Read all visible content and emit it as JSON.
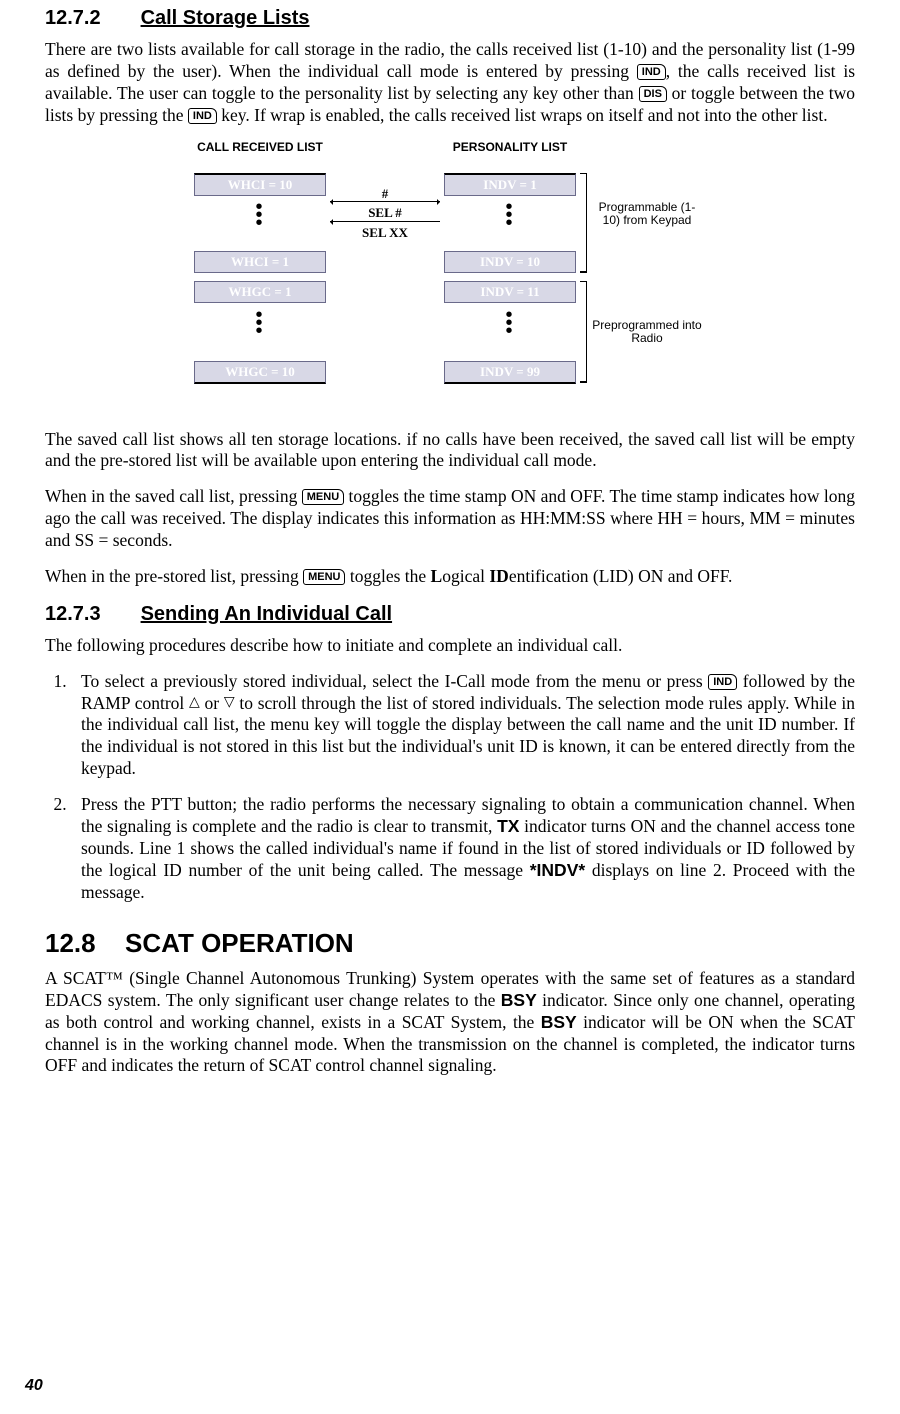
{
  "sections": {
    "s1": {
      "num": "12.7.2",
      "title": "Call Storage Lists"
    },
    "s2": {
      "num": "12.7.3",
      "title": "Sending An Individual Call"
    },
    "s3": {
      "num": "12.8",
      "title": "SCAT OPERATION"
    }
  },
  "keys": {
    "ind": "IND",
    "dis": "DIS",
    "menu": "MENU"
  },
  "body": {
    "p1a": "There are two lists available for call storage in the radio, the calls received list (1-10) and the personality list (1-99 as defined by the user). When the individual call mode is entered by pressing ",
    "p1b": ", the calls received list is available. The user can toggle to the personality list by selecting any key other than ",
    "p1c": " or toggle between the two lists by pressing the ",
    "p1d": " key. If wrap is enabled, the calls received list wraps on itself and not into the other list.",
    "p2": "The saved call list shows all ten storage locations. if no calls have been received, the saved call list will be empty and the pre-stored list will be available upon entering the individual call mode.",
    "p3a": "When in the saved call list, pressing ",
    "p3b": " toggles the time stamp ON and OFF. The time stamp indicates how long ago the call was received. The display indicates this information as HH:MM:SS where HH = hours, MM = minutes and SS = seconds.",
    "p4a": "When in the pre-stored list, pressing ",
    "p4b": " toggles the ",
    "p4c": "ogical ",
    "p4d": "entification (LID) ON and OFF.",
    "p5": "The following procedures describe how to initiate and complete an individual call.",
    "li1a": "To select a previously stored individual, select the I-Call mode from the menu or press ",
    "li1b": " followed by the RAMP control ",
    "li1c": " or ",
    "li1d": " to scroll through the list of stored individuals. The selection mode rules apply. While in the individual call list, the menu key will toggle the display between the call name and the unit ID number. If the individual is not stored in this list but the individual's unit ID is known, it can be entered directly from the keypad.",
    "li2a": "Press the PTT button; the radio performs the necessary signaling to obtain a communication channel. When the signaling is complete and the radio is clear to transmit, ",
    "li2b": " indicator turns ON and the channel access tone sounds. Line 1 shows the called individual's name if found in the list of stored individuals or ID followed by the logical ID number of the unit being called. The message ",
    "li2c": " displays on line 2. Proceed with the message.",
    "p6a": "A SCAT™ (Single Channel Autonomous Trunking) System operates with the same set of features as a standard EDACS system. The only significant user change relates to the ",
    "p6b": " indicator. Since only one channel, operating as both control and working channel, exists in a SCAT System, the ",
    "p6c": " indicator will be ON when the SCAT channel is in the working channel mode. When the transmission on the channel is completed, the indicator turns OFF and indicates the return of SCAT control channel signaling."
  },
  "bold": {
    "L": "L",
    "ID": "ID",
    "TX": "TX",
    "INDV": "*INDV*",
    "BSY": "BSY"
  },
  "diagram": {
    "hdr1": "CALL RECEIVED LIST",
    "hdr2": "PERSONALITY LIST",
    "c1": "WHCI = 10",
    "c2": "WHCI = 1",
    "c3": "WHGC = 1",
    "c4": "WHGC = 10",
    "d1": "INDV = 1",
    "d2": "INDV = 10",
    "d3": "INDV = 11",
    "d4": "INDV = 99",
    "mid1": "#",
    "mid2": "SEL #",
    "mid3": "SEL XX",
    "side1": "Programmable (1-10) from Keypad",
    "side2": "Preprogrammed into Radio"
  },
  "page": "40"
}
